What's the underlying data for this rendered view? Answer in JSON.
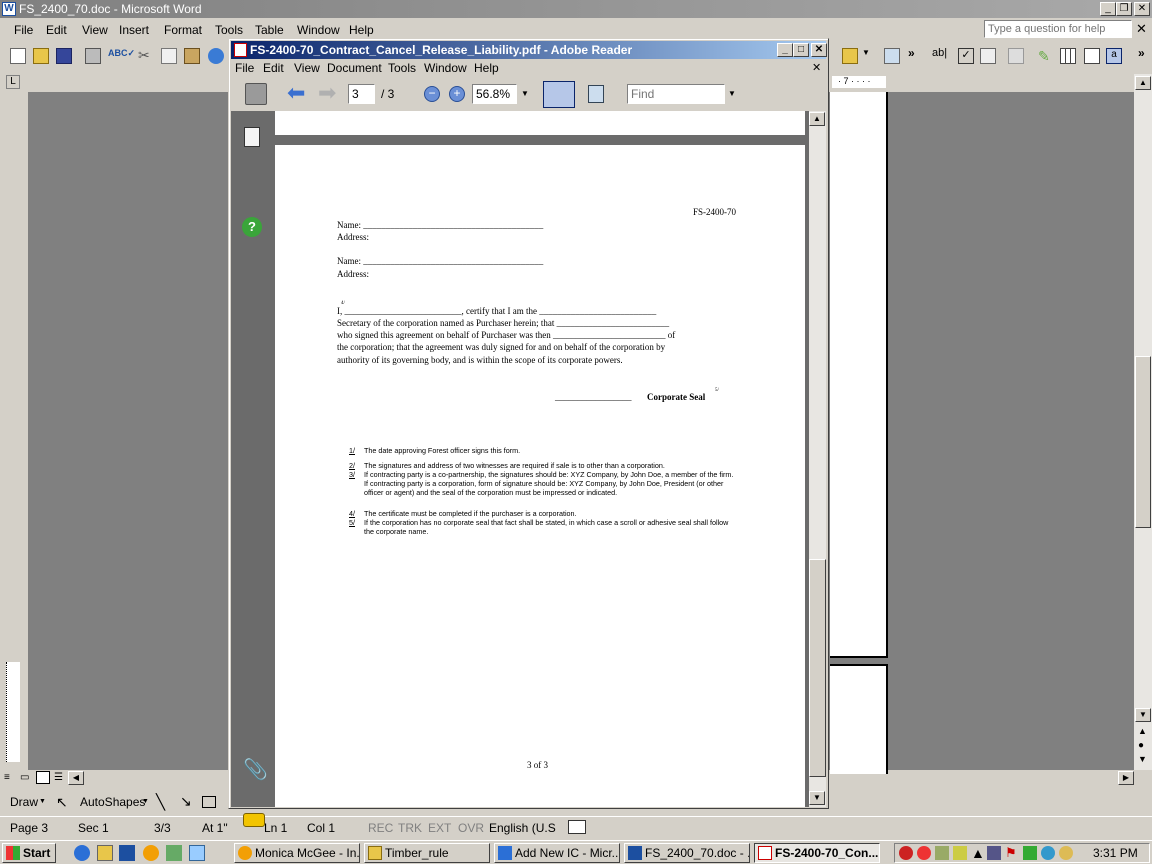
{
  "word": {
    "title": "FS_2400_70.doc - Microsoft Word",
    "menu": [
      "File",
      "Edit",
      "View",
      "Insert",
      "Format",
      "Tools",
      "Table",
      "Window",
      "Help"
    ],
    "help_placeholder": "Type a question for help",
    "ruler_mark": "· 7 · · · ·",
    "draw_label": "Draw",
    "autoshapes_label": "AutoShapes",
    "status": {
      "page": "Page 3",
      "sec": "Sec 1",
      "pages": "3/3",
      "at": "At 1\"",
      "ln": "Ln 1",
      "col": "Col 1",
      "rec": "REC",
      "trk": "TRK",
      "ext": "EXT",
      "ovr": "OVR",
      "lang": "English (U.S"
    }
  },
  "reader": {
    "title": "FS-2400-70_Contract_Cancel_Release_Liability.pdf - Adobe Reader",
    "menu": [
      "File",
      "Edit",
      "View",
      "Document",
      "Tools",
      "Window",
      "Help"
    ],
    "page_current": "3",
    "page_total": "/ 3",
    "zoom": "56.8%",
    "find_placeholder": "Find"
  },
  "pdf": {
    "form_id": "FS-2400-70",
    "name_line": "Name:  ________________________________________",
    "address": "Address:",
    "cert_lines": [
      "I, __________________________, certify that I am the __________________________",
      "Secretary of the corporation named as Purchaser herein; that _________________________",
      "who signed this agreement on behalf of Purchaser was then _________________________ of",
      "the corporation; that the agreement was duly signed for and on behalf of the corporation by",
      "authority of its governing body, and is within the scope of its corporate powers."
    ],
    "cert_sup": "4/",
    "seal_line": "_________________",
    "seal_label": "Corporate Seal",
    "seal_sup": "5/",
    "footnotes": [
      {
        "num": "1/",
        "text": "The date approving Forest officer signs this form."
      },
      {
        "num": "2/",
        "text": "The signatures and address of two witnesses are required if sale is to other than a corporation."
      },
      {
        "num": "3/",
        "text": "If contracting party is a co-partnership, the signatures should be: XYZ Company, by John Doe, a member of the firm."
      },
      {
        "num": "",
        "text": " If contracting party is a corporation, form of signature should be:  XYZ Company, by John Doe, President (or other"
      },
      {
        "num": "",
        "text": "officer or agent) and the seal of the corporation must be impressed or indicated."
      },
      {
        "num": "4/",
        "text": "The certificate must be completed if the purchaser is a corporation."
      },
      {
        "num": "5/",
        "text": "If the corporation has no corporate seal that fact shall be stated, in which case a scroll or adhesive seal shall follow"
      },
      {
        "num": "",
        "text": "the corporate name."
      }
    ],
    "page_footer": "3 of 3"
  },
  "taskbar": {
    "start": "Start",
    "tasks": [
      "Monica McGee - In...",
      "Timber_rule",
      "Add New IC - Micr...",
      "FS_2400_70.doc - ...",
      "FS-2400-70_Con..."
    ],
    "clock": "3:31 PM"
  }
}
